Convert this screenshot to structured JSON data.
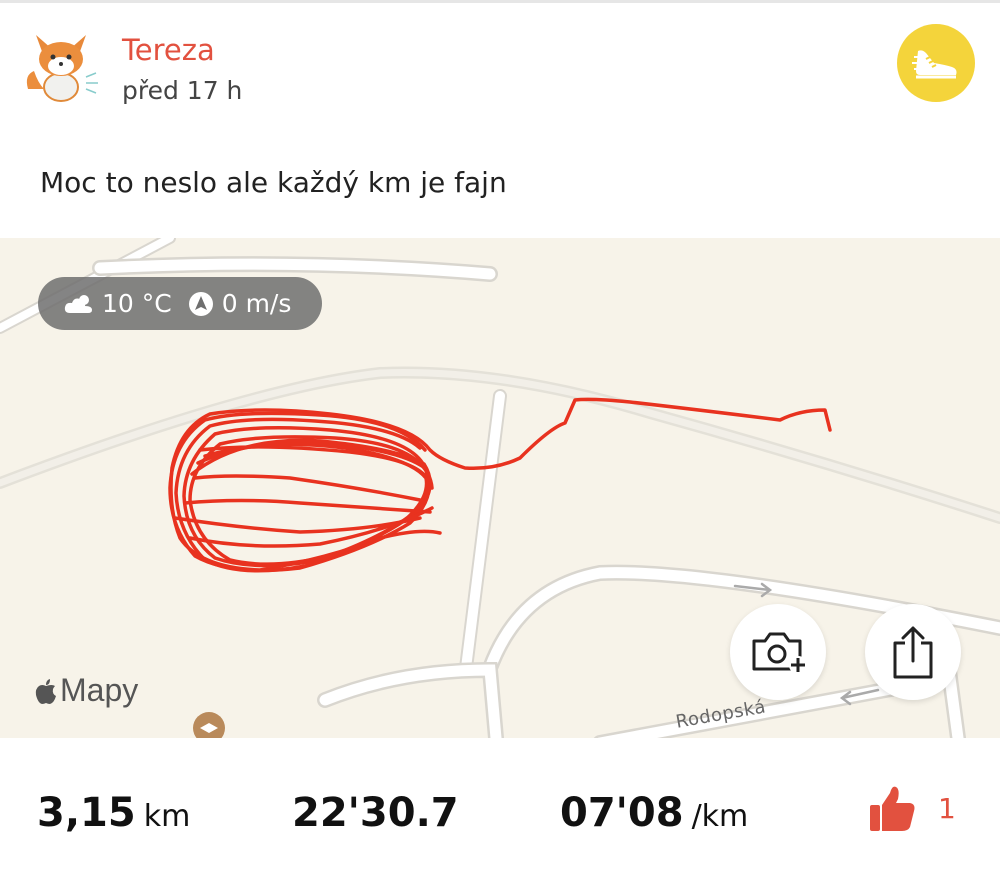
{
  "post": {
    "user_name": "Tereza",
    "time_ago": "před 17 h",
    "text": "Moc to neslo ale každý km je fajn",
    "avatar_icon": "fox-avatar-icon",
    "activity_icon": "running-shoe-icon",
    "activity_badge_color": "#f4d43b"
  },
  "map": {
    "weather": {
      "temperature": "10 °C",
      "wind": "0 m/s",
      "weather_icon": "partly-cloudy-icon",
      "wind_icon": "navigation-arrow-icon"
    },
    "provider": "Mapy",
    "street_label": "Rodopská",
    "route_color": "#e8321f",
    "buttons": {
      "add_photo_icon": "camera-plus-icon",
      "share_icon": "share-icon"
    }
  },
  "stats": {
    "distance_value": "3,15",
    "distance_unit": "km",
    "duration": "22'30.7",
    "pace_value": "07'08",
    "pace_unit": "/km",
    "likes": "1",
    "like_icon": "thumbs-up-icon",
    "accent_color": "#e2513f"
  }
}
